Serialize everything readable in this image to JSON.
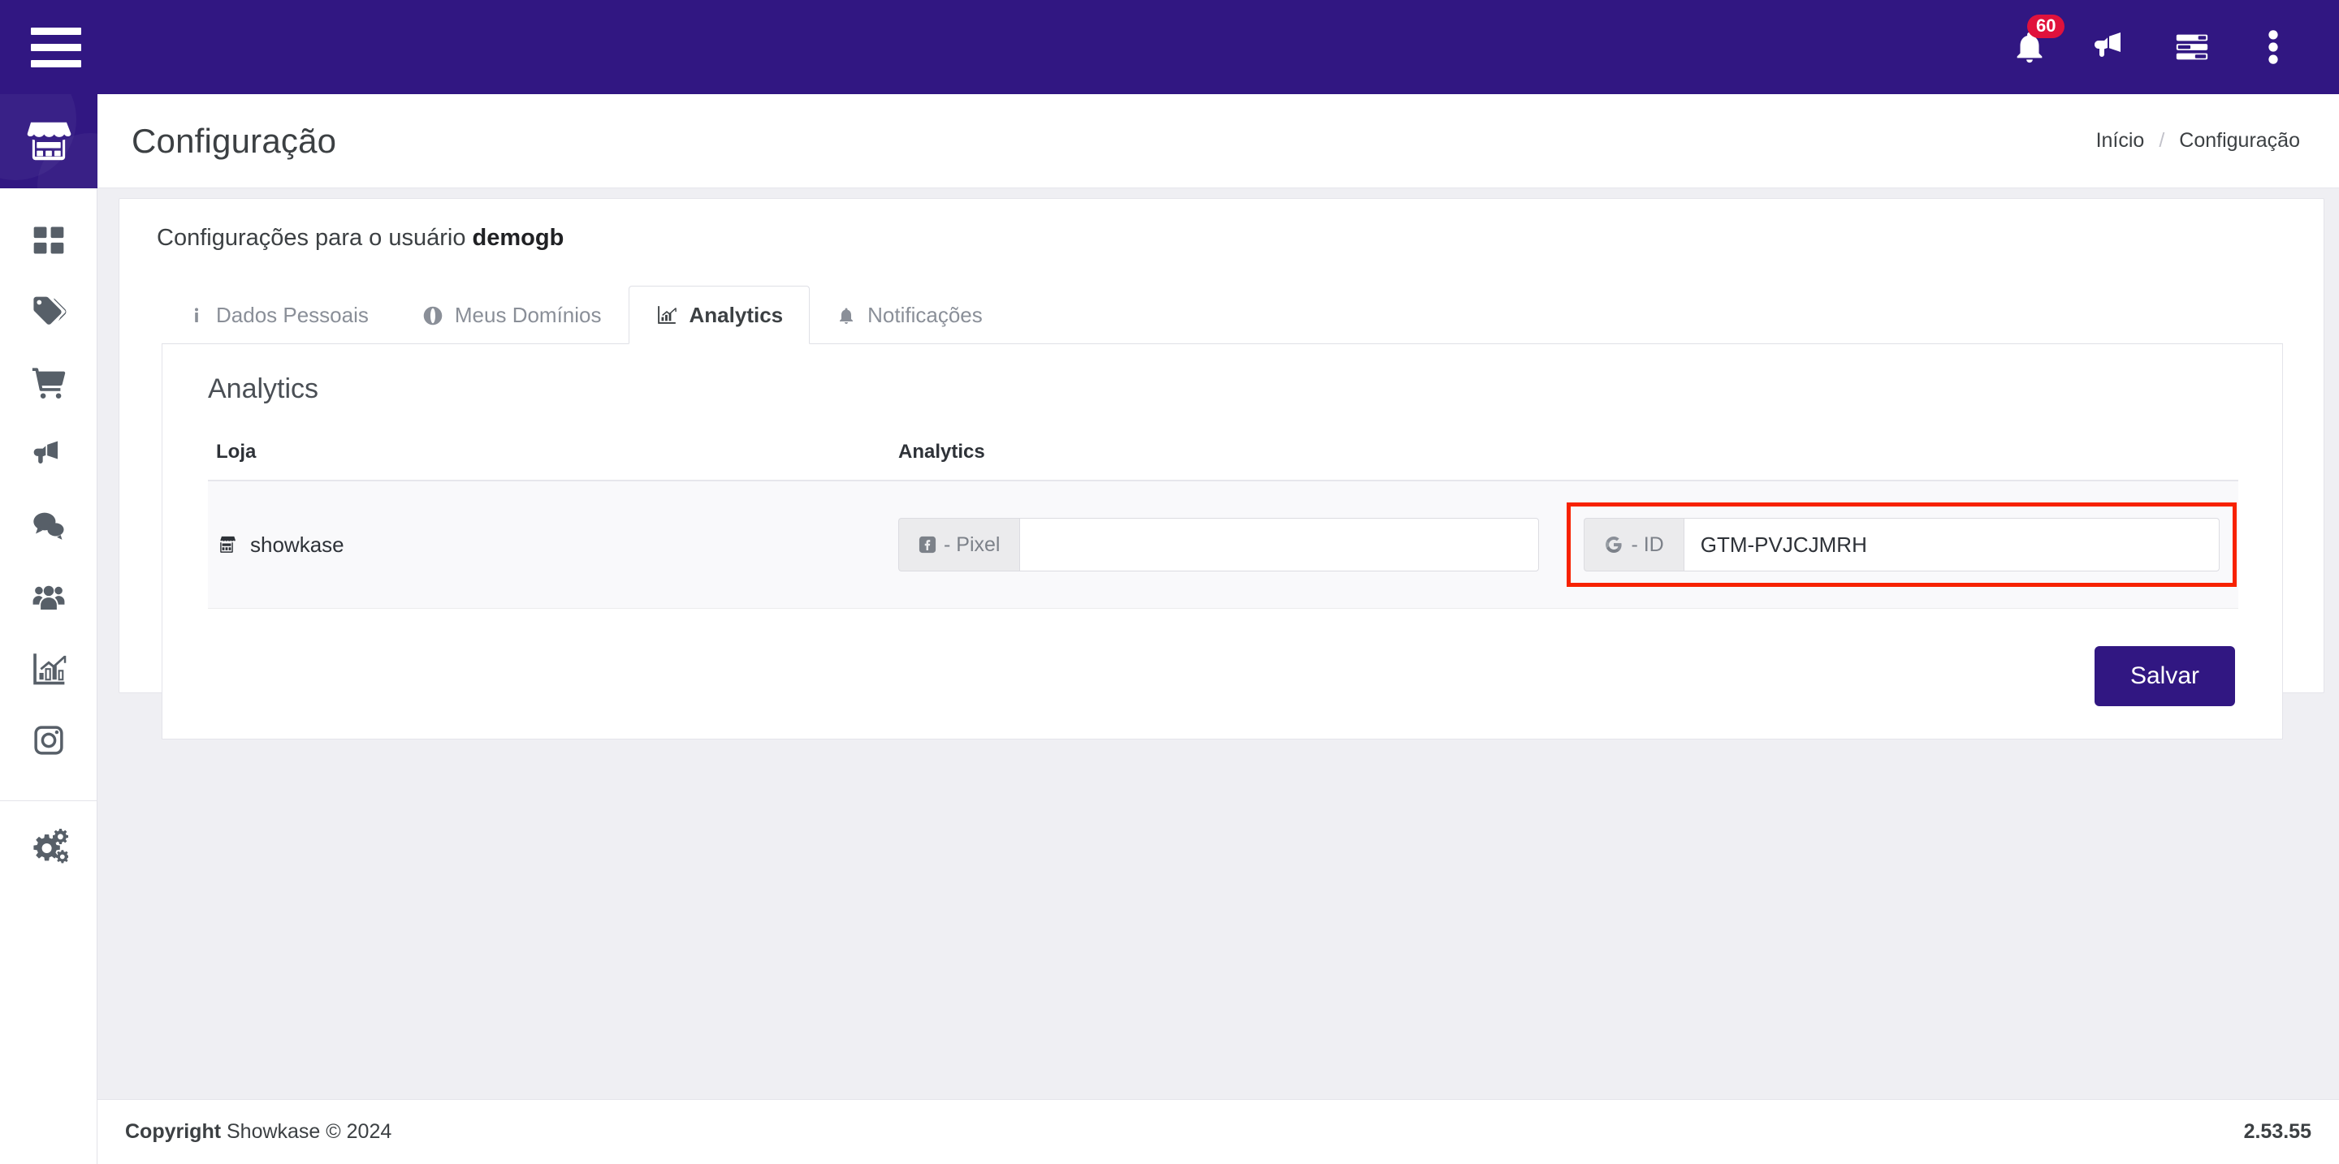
{
  "colors": {
    "brand_purple": "#311782",
    "badge_red": "#e0123c",
    "highlight_red": "#f72200",
    "text_dark": "#3c4043",
    "muted": "#8a8f98"
  },
  "topbar": {
    "menu_toggle": "menu-toggle",
    "icons": [
      {
        "name": "notifications-bell-icon",
        "badge": "60"
      },
      {
        "name": "announcements-megaphone-icon",
        "badge": ""
      },
      {
        "name": "tasks-list-icon",
        "badge": ""
      },
      {
        "name": "more-options-icon",
        "badge": ""
      }
    ]
  },
  "sidebar": {
    "brand": "store-brand-icon",
    "items": [
      {
        "icon": "dashboard-grid-icon",
        "label": "Dashboard"
      },
      {
        "icon": "tags-icon",
        "label": "Produtos"
      },
      {
        "icon": "shopping-cart-icon",
        "label": "Pedidos"
      },
      {
        "icon": "megaphone-icon",
        "label": "Marketing"
      },
      {
        "icon": "chat-bubbles-icon",
        "label": "Mensagens"
      },
      {
        "icon": "users-group-icon",
        "label": "Clientes"
      },
      {
        "icon": "chart-analytics-icon",
        "label": "Relatórios"
      },
      {
        "icon": "instagram-icon",
        "label": "Instagram"
      },
      {
        "icon": "settings-gears-icon",
        "label": "Configuração"
      }
    ]
  },
  "header": {
    "title": "Configuração",
    "breadcrumb": {
      "home": "Início",
      "separator": "/",
      "current": "Configuração"
    }
  },
  "card": {
    "heading_prefix": "Configurações para o usuário ",
    "heading_user": "demogb",
    "tabs": [
      {
        "label": "Dados Pessoais",
        "icon": "info-icon",
        "active": false
      },
      {
        "label": "Meus Domínios",
        "icon": "globe-icon",
        "active": false
      },
      {
        "label": "Analytics",
        "icon": "chart-line-icon",
        "active": true
      },
      {
        "label": "Notificações",
        "icon": "bell-icon",
        "active": false
      }
    ],
    "panel_title": "Analytics",
    "table": {
      "columns": [
        "Loja",
        "Analytics"
      ],
      "rows": [
        {
          "store_icon": "store-icon",
          "store": "showkase",
          "fields": [
            {
              "name": "facebook-pixel-field",
              "prefix_icon": "facebook-icon",
              "prefix_label": "- Pixel",
              "value": "",
              "placeholder": "",
              "highlighted": false
            },
            {
              "name": "google-tag-manager-id-field",
              "prefix_icon": "google-icon",
              "prefix_label": "- ID",
              "value": "GTM-PVJCJMRH",
              "placeholder": "",
              "highlighted": true
            }
          ]
        }
      ]
    },
    "save_label": "Salvar"
  },
  "footer": {
    "copyright_bold": "Copyright",
    "copyright_rest": " Showkase © 2024",
    "version": "2.53.55"
  }
}
